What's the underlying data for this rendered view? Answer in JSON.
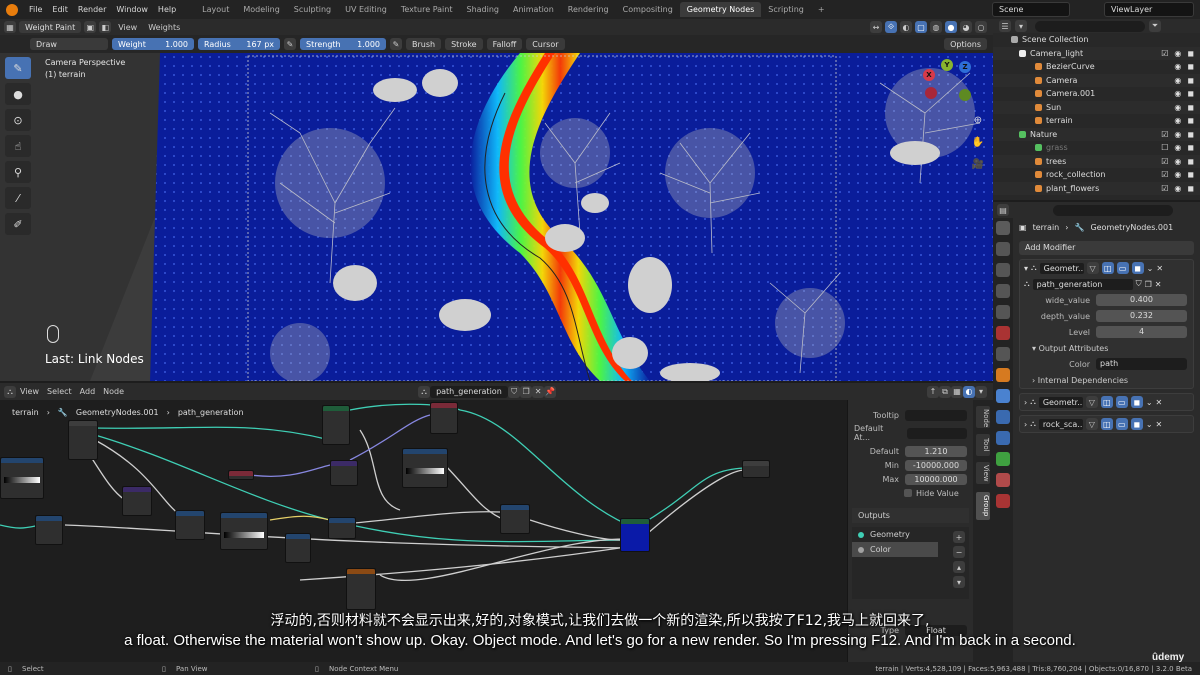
{
  "menubar": {
    "menus": [
      "File",
      "Edit",
      "Render",
      "Window",
      "Help"
    ],
    "workspaces": [
      "Layout",
      "Modeling",
      "Sculpting",
      "UV Editing",
      "Texture Paint",
      "Shading",
      "Animation",
      "Rendering",
      "Compositing",
      "Geometry Nodes",
      "Scripting"
    ],
    "active_workspace": "Geometry Nodes",
    "add_tab": "+",
    "scene": "Scene",
    "view_layer": "ViewLayer"
  },
  "viewport_header": {
    "mode": "Weight Paint",
    "view": "View",
    "weights": "Weights"
  },
  "tool_settings": {
    "brush": "Draw",
    "weight_label": "Weight",
    "weight_value": "1.000",
    "radius_label": "Radius",
    "radius_value": "167 px",
    "strength_label": "Strength",
    "strength_value": "1.000",
    "brush_menu": "Brush",
    "stroke_menu": "Stroke",
    "falloff_menu": "Falloff",
    "cursor_menu": "Cursor",
    "options_menu": "Options"
  },
  "viewport": {
    "perspective": "Camera Perspective",
    "object": "(1) terrain",
    "last_op": "Last: Link Nodes",
    "axis_x": "X",
    "axis_y": "Y",
    "axis_z": "Z"
  },
  "node_editor": {
    "menus": [
      "View",
      "Select",
      "Add",
      "Node"
    ],
    "node_group": "path_generation",
    "breadcrumb": [
      "terrain",
      "GeometryNodes.001",
      "path_generation"
    ]
  },
  "npanel": {
    "tooltip_label": "Tooltip",
    "default_attr_label": "Default At...",
    "default_label": "Default",
    "default_value": "1.210",
    "min_label": "Min",
    "min_value": "-10000.000",
    "max_label": "Max",
    "max_value": "10000.000",
    "hide_value": "Hide Value",
    "outputs_label": "Outputs",
    "outputs": [
      "Geometry",
      "Color"
    ],
    "type_label": "Type",
    "type_value": "Float",
    "tabs": [
      "Node",
      "Tool",
      "View",
      "Group"
    ]
  },
  "outliner": {
    "rows": [
      {
        "label": "Scene Collection",
        "indent": 0
      },
      {
        "label": "Camera_light",
        "indent": 1
      },
      {
        "label": "BezierCurve",
        "indent": 2
      },
      {
        "label": "Camera",
        "indent": 2
      },
      {
        "label": "Camera.001",
        "indent": 2
      },
      {
        "label": "Sun",
        "indent": 2
      },
      {
        "label": "terrain",
        "indent": 2
      },
      {
        "label": "Nature",
        "indent": 1
      },
      {
        "label": "grass",
        "indent": 2
      },
      {
        "label": "trees",
        "indent": 2
      },
      {
        "label": "rock_collection",
        "indent": 2
      },
      {
        "label": "plant_flowers",
        "indent": 2
      }
    ]
  },
  "properties": {
    "object": "terrain",
    "modifier_name": "GeometryNodes.001",
    "add_modifier": "Add Modifier",
    "mod1_name": "Geometr...",
    "node_group": "path_generation",
    "fields": [
      {
        "label": "wide_value",
        "value": "0.400"
      },
      {
        "label": "depth_value",
        "value": "0.232"
      },
      {
        "label": "Level",
        "value": "4"
      }
    ],
    "output_attributes": "Output Attributes",
    "color_label": "Color",
    "color_value": "path",
    "internal_deps": "Internal Dependencies",
    "mod2_name": "Geometr...",
    "mod3_name": "rock_sca..."
  },
  "statusbar": {
    "select": "Select",
    "pan": "Pan View",
    "context": "Node Context Menu",
    "stats": "terrain | Verts:4,528,109 | Faces:5,963,488 | Tris:8,760,204 | Objects:0/16,870 | 3.2.0 Beta"
  },
  "subtitles": {
    "cn": "浮动的,否则材料就不会显示出来,好的,对象模式,让我们去做一个新的渲染,所以我按了F12,我马上就回来了,",
    "en": "a float. Otherwise the material won't show up. Okay. Object mode. And let's go for a new render. So I'm pressing F12. And I'm back in a second."
  },
  "watermark": "ûdemy",
  "colors": {
    "accent": "#4772b3",
    "weight_blue": "#0a1f9e",
    "path_red": "#ff3a00",
    "node_link_teal": "#3fcfb5"
  }
}
